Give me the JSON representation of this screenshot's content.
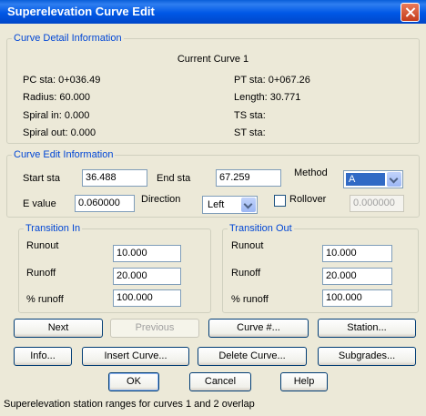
{
  "window": {
    "title": "Superelevation Curve Edit"
  },
  "detail": {
    "legend": "Curve Detail Information",
    "current_curve": "Current Curve 1",
    "pc_sta": "PC sta: 0+036.49",
    "pt_sta": "PT sta: 0+067.26",
    "radius": "Radius: 60.000",
    "length": "Length: 30.771",
    "spiral_in": "Spiral in: 0.000",
    "ts_sta": "TS sta:",
    "spiral_out": "Spiral out: 0.000",
    "st_sta": "ST sta:"
  },
  "edit": {
    "legend": "Curve Edit Information",
    "start_sta_label": "Start sta",
    "start_sta_value": "36.488",
    "end_sta_label": "End sta",
    "end_sta_value": "67.259",
    "method_label": "Method",
    "method_value": "A",
    "e_value_label": "E value",
    "e_value": "0.060000",
    "direction_label": "Direction",
    "direction_value": "Left",
    "rollover_label": "Rollover",
    "rollover_checked": false,
    "rollover_value": "0.000000"
  },
  "transition_in": {
    "legend": "Transition In",
    "runout_label": "Runout",
    "runout_value": "10.000",
    "runoff_label": "Runoff",
    "runoff_value": "20.000",
    "pct_runoff_label": "% runoff",
    "pct_runoff_value": "100.000"
  },
  "transition_out": {
    "legend": "Transition Out",
    "runout_label": "Runout",
    "runout_value": "10.000",
    "runoff_label": "Runoff",
    "runoff_value": "20.000",
    "pct_runoff_label": "% runoff",
    "pct_runoff_value": "100.000"
  },
  "buttons": {
    "next": "Next",
    "previous": "Previous",
    "curve_num": "Curve #...",
    "station": "Station...",
    "info": "Info...",
    "insert_curve": "Insert Curve...",
    "delete_curve": "Delete Curve...",
    "subgrades": "Subgrades...",
    "ok": "OK",
    "cancel": "Cancel",
    "help": "Help"
  },
  "status": "Superelevation station ranges for curves 1 and 2 overlap",
  "colors": {
    "title_bar": "#0058e6",
    "legend_text": "#0046d5",
    "dialog_bg": "#ece9d8",
    "selection": "#316ac5"
  }
}
